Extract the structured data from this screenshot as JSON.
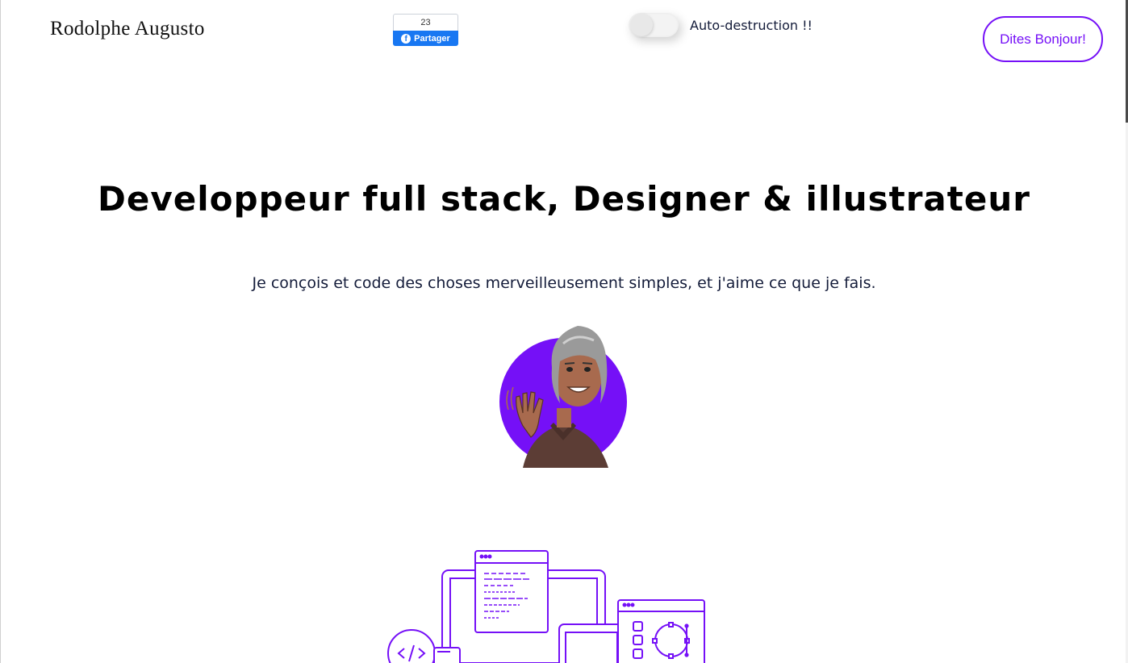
{
  "header": {
    "logo_text": "Rodolphe Augusto",
    "facebook": {
      "count": "23",
      "share_label": "Partager",
      "brand_color": "#1877f2"
    },
    "toggle": {
      "label": "Auto-destruction !!",
      "state": "off"
    },
    "cta_label": "Dites Bonjour!"
  },
  "hero": {
    "title": "Developpeur full stack, Designer & illustrateur",
    "subtitle": "Je conçois et code des choses merveilleusement simples, et j'aime ce que je fais."
  },
  "colors": {
    "accent": "#7510f7",
    "text": "#141c3a"
  }
}
